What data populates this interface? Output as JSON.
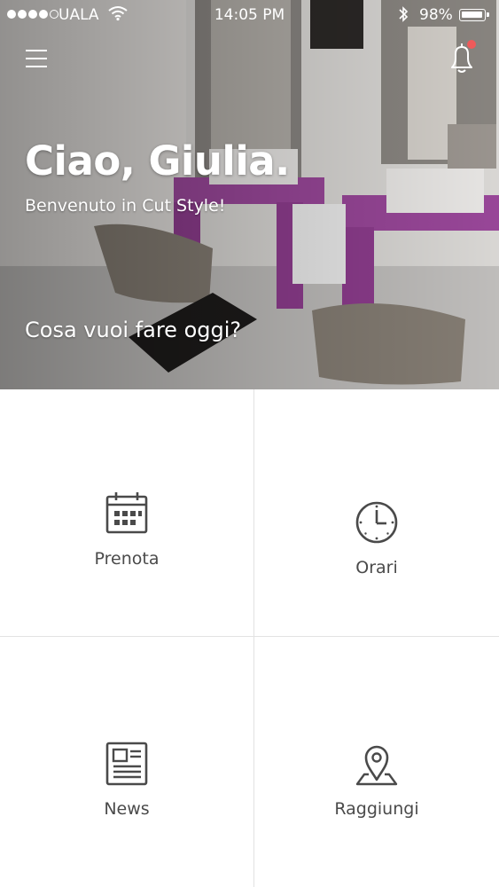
{
  "status_bar": {
    "carrier": "UALA",
    "time": "14:05 PM",
    "battery": "98%"
  },
  "header": {
    "greeting": "Ciao, Giulia.",
    "welcome": "Benvenuto in Cut Style!",
    "question": "Cosa vuoi fare oggi?"
  },
  "icons": {
    "menu": "hamburger-menu-icon",
    "notifications": "bell-icon"
  },
  "colors": {
    "notification_badge": "#ef5a5a",
    "icon_stroke": "#4a4a4a",
    "label_text": "#4a4a4a"
  },
  "menu_tiles": [
    {
      "label": "Prenota",
      "icon": "calendar-icon"
    },
    {
      "label": "Orari",
      "icon": "clock-icon"
    },
    {
      "label": "News",
      "icon": "newspaper-icon"
    },
    {
      "label": "Raggiungi",
      "icon": "map-pin-icon"
    }
  ]
}
